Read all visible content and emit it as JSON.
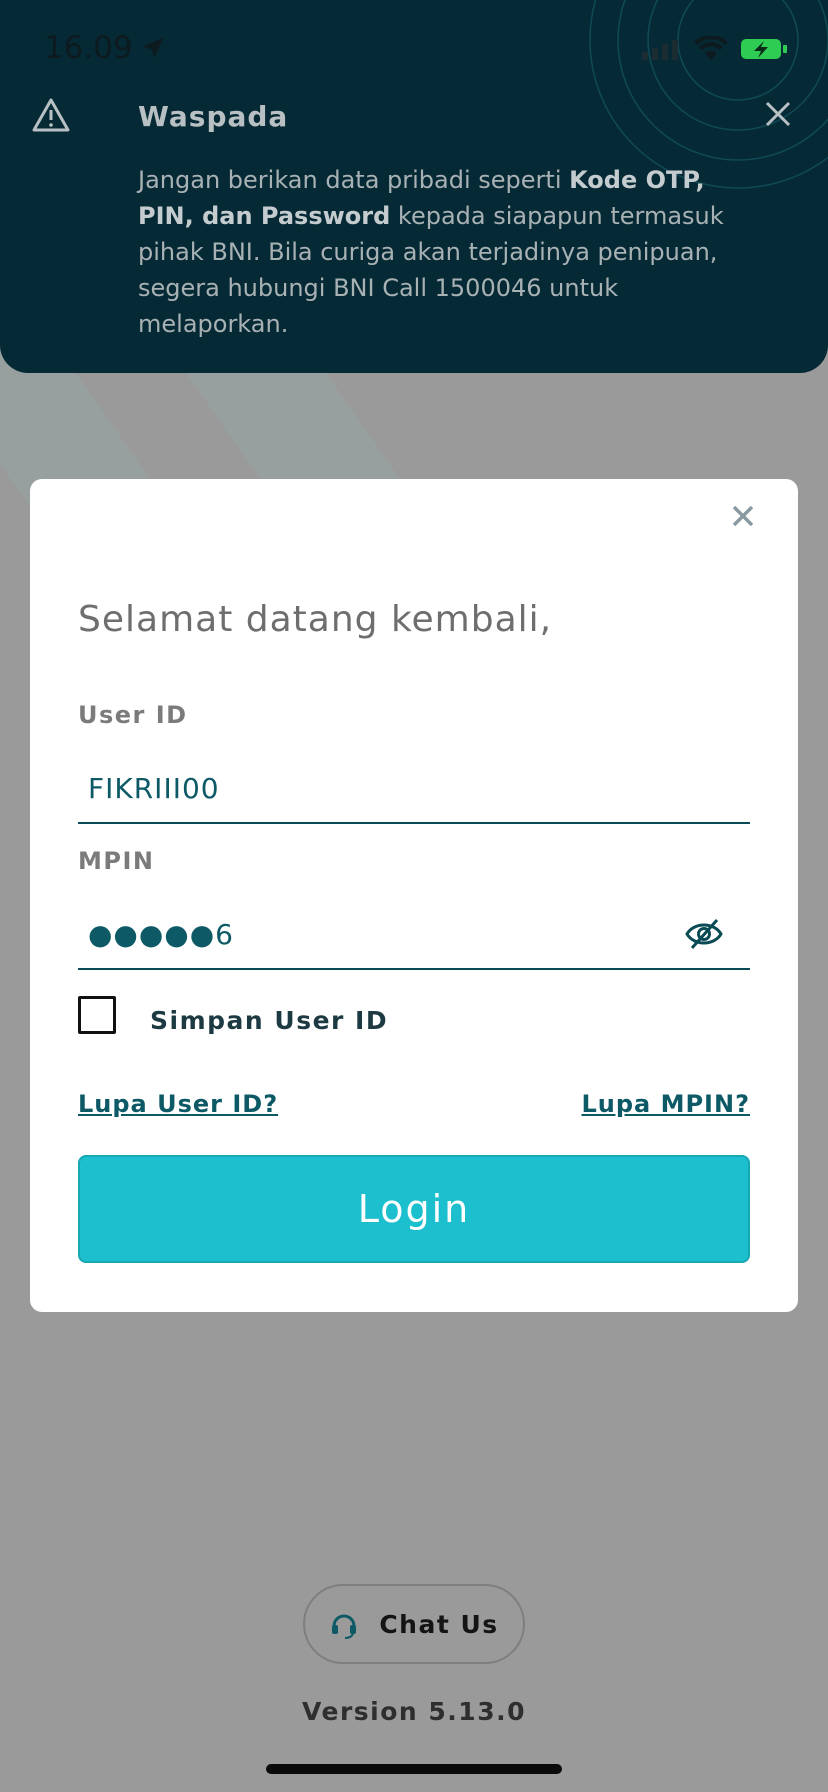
{
  "status_bar": {
    "time": "16.09"
  },
  "banner": {
    "title": "Waspada",
    "text_1": "Jangan berikan data pribadi seperti ",
    "bold_1": "Kode OTP, PIN, dan Password",
    "text_2": " kepada siapapun termasuk pihak BNI. Bila curiga akan terjadinya penipuan, segera hubungi BNI Call 1500046 untuk melaporkan."
  },
  "login": {
    "greeting": "Selamat datang kembali,",
    "user_id_label": "User ID",
    "user_id_value": "FIKRIII00",
    "mpin_label": "MPIN",
    "mpin_value": "●●●●●6",
    "remember_label": "Simpan User ID",
    "forgot_user_id": "Lupa User ID?",
    "forgot_mpin": "Lupa MPIN?",
    "login_label": "Login"
  },
  "footer": {
    "chat_label": "Chat Us",
    "version": "Version 5.13.0"
  },
  "colors": {
    "banner_bg": "#062a35",
    "accent": "#1bbfcd",
    "text_teal": "#0d5a66"
  }
}
